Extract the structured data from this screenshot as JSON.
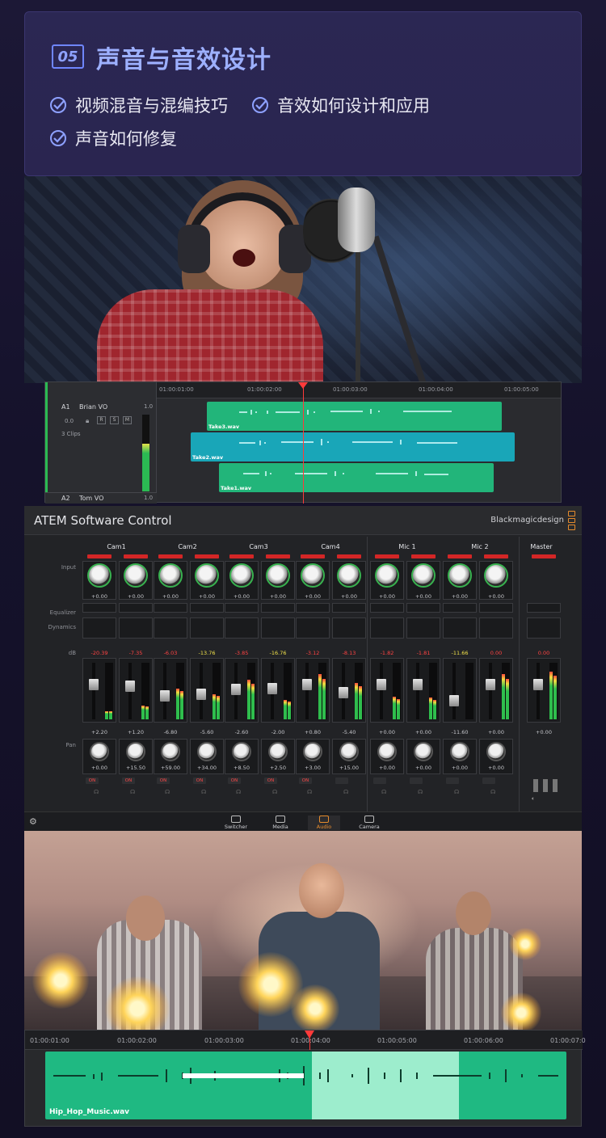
{
  "section": {
    "badge": "05",
    "title": "声音与音效设计",
    "bullets": [
      "视频混音与混编技巧",
      "音效如何设计和应用",
      "声音如何修复"
    ],
    "accent": "#8ea1ff"
  },
  "daw": {
    "ruler": [
      "01:00:01:00",
      "01:00:02:00",
      "01:00:03:00",
      "01:00:04:00",
      "01:00:05:00"
    ],
    "track1": {
      "id": "A1",
      "name": "Brian VO",
      "level": "1.0",
      "volume": "0.0",
      "buttons": [
        "R",
        "S",
        "M"
      ],
      "clips_count": "3 Clips"
    },
    "track2": {
      "id": "A2",
      "name": "Tom VO",
      "level": "1.0"
    },
    "clips": [
      "Take3.wav",
      "Take2.wav",
      "Take1.wav"
    ]
  },
  "atem": {
    "title": "ATEM Software Control",
    "brand": "Blackmagicdesign",
    "groups": [
      "Cam1",
      "Cam2",
      "Cam3",
      "Cam4",
      "Mic 1",
      "Mic 2",
      "Master"
    ],
    "row_labels": {
      "input": "Input",
      "equalizer": "Equalizer",
      "dynamics": "Dynamics",
      "db": "dB",
      "pan": "Pan"
    },
    "input_gain": [
      "+0.00",
      "+0.00",
      "+0.00",
      "+0.00",
      "+0.00",
      "+0.00",
      "+0.00",
      "+0.00",
      "+0.00",
      "+0.00",
      "+0.00",
      "+0.00"
    ],
    "db_peaks": [
      "-20.39",
      "-7.35",
      "-6.03",
      "-13.76",
      "-3.85",
      "-16.76",
      "-3.12",
      "-8.13",
      "-1.82",
      "-1.81",
      "-11.66",
      "0.00",
      "0.00"
    ],
    "fader_values": [
      "+2.20",
      "+1.20",
      "-6.80",
      "-5.60",
      "-2.60",
      "-2.00",
      "+0.80",
      "-5.40",
      "+0.00",
      "+0.00",
      "-11.60",
      "+0.00",
      "+0.00"
    ],
    "pan_values": [
      "+0.00",
      "+15.50",
      "+59.00",
      "+34.00",
      "+8.50",
      "+2.50",
      "+3.00",
      "+15.00",
      "+0.00",
      "+0.00",
      "+0.00",
      "+0.00"
    ],
    "on_states": [
      "ON",
      "AFV",
      "ON",
      "",
      "ON",
      "",
      "ON",
      "AFV",
      "ON",
      "AFV",
      "ON",
      "",
      "ON",
      "",
      "",
      ""
    ],
    "nav": [
      "Switcher",
      "Media",
      "Audio",
      "Camera"
    ],
    "active_nav": "Audio"
  },
  "music": {
    "ruler": [
      "01:00:01:00",
      "01:00:02:00",
      "01:00:03:00",
      "01:00:04:00",
      "01:00:05:00",
      "01:00:06:00",
      "01:00:07:0"
    ],
    "clip": "Hip_Hop_Music.wav"
  }
}
